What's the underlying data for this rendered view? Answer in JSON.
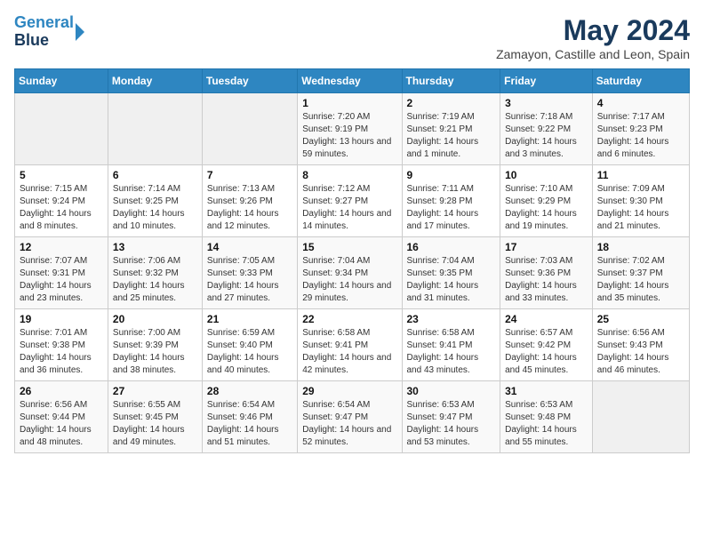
{
  "header": {
    "logo_line1": "General",
    "logo_line2": "Blue",
    "title": "May 2024",
    "subtitle": "Zamayon, Castille and Leon, Spain"
  },
  "days_of_week": [
    "Sunday",
    "Monday",
    "Tuesday",
    "Wednesday",
    "Thursday",
    "Friday",
    "Saturday"
  ],
  "weeks": [
    [
      {
        "day": "",
        "info": ""
      },
      {
        "day": "",
        "info": ""
      },
      {
        "day": "",
        "info": ""
      },
      {
        "day": "1",
        "info": "Sunrise: 7:20 AM\nSunset: 9:19 PM\nDaylight: 13 hours and 59 minutes."
      },
      {
        "day": "2",
        "info": "Sunrise: 7:19 AM\nSunset: 9:21 PM\nDaylight: 14 hours and 1 minute."
      },
      {
        "day": "3",
        "info": "Sunrise: 7:18 AM\nSunset: 9:22 PM\nDaylight: 14 hours and 3 minutes."
      },
      {
        "day": "4",
        "info": "Sunrise: 7:17 AM\nSunset: 9:23 PM\nDaylight: 14 hours and 6 minutes."
      }
    ],
    [
      {
        "day": "5",
        "info": "Sunrise: 7:15 AM\nSunset: 9:24 PM\nDaylight: 14 hours and 8 minutes."
      },
      {
        "day": "6",
        "info": "Sunrise: 7:14 AM\nSunset: 9:25 PM\nDaylight: 14 hours and 10 minutes."
      },
      {
        "day": "7",
        "info": "Sunrise: 7:13 AM\nSunset: 9:26 PM\nDaylight: 14 hours and 12 minutes."
      },
      {
        "day": "8",
        "info": "Sunrise: 7:12 AM\nSunset: 9:27 PM\nDaylight: 14 hours and 14 minutes."
      },
      {
        "day": "9",
        "info": "Sunrise: 7:11 AM\nSunset: 9:28 PM\nDaylight: 14 hours and 17 minutes."
      },
      {
        "day": "10",
        "info": "Sunrise: 7:10 AM\nSunset: 9:29 PM\nDaylight: 14 hours and 19 minutes."
      },
      {
        "day": "11",
        "info": "Sunrise: 7:09 AM\nSunset: 9:30 PM\nDaylight: 14 hours and 21 minutes."
      }
    ],
    [
      {
        "day": "12",
        "info": "Sunrise: 7:07 AM\nSunset: 9:31 PM\nDaylight: 14 hours and 23 minutes."
      },
      {
        "day": "13",
        "info": "Sunrise: 7:06 AM\nSunset: 9:32 PM\nDaylight: 14 hours and 25 minutes."
      },
      {
        "day": "14",
        "info": "Sunrise: 7:05 AM\nSunset: 9:33 PM\nDaylight: 14 hours and 27 minutes."
      },
      {
        "day": "15",
        "info": "Sunrise: 7:04 AM\nSunset: 9:34 PM\nDaylight: 14 hours and 29 minutes."
      },
      {
        "day": "16",
        "info": "Sunrise: 7:04 AM\nSunset: 9:35 PM\nDaylight: 14 hours and 31 minutes."
      },
      {
        "day": "17",
        "info": "Sunrise: 7:03 AM\nSunset: 9:36 PM\nDaylight: 14 hours and 33 minutes."
      },
      {
        "day": "18",
        "info": "Sunrise: 7:02 AM\nSunset: 9:37 PM\nDaylight: 14 hours and 35 minutes."
      }
    ],
    [
      {
        "day": "19",
        "info": "Sunrise: 7:01 AM\nSunset: 9:38 PM\nDaylight: 14 hours and 36 minutes."
      },
      {
        "day": "20",
        "info": "Sunrise: 7:00 AM\nSunset: 9:39 PM\nDaylight: 14 hours and 38 minutes."
      },
      {
        "day": "21",
        "info": "Sunrise: 6:59 AM\nSunset: 9:40 PM\nDaylight: 14 hours and 40 minutes."
      },
      {
        "day": "22",
        "info": "Sunrise: 6:58 AM\nSunset: 9:41 PM\nDaylight: 14 hours and 42 minutes."
      },
      {
        "day": "23",
        "info": "Sunrise: 6:58 AM\nSunset: 9:41 PM\nDaylight: 14 hours and 43 minutes."
      },
      {
        "day": "24",
        "info": "Sunrise: 6:57 AM\nSunset: 9:42 PM\nDaylight: 14 hours and 45 minutes."
      },
      {
        "day": "25",
        "info": "Sunrise: 6:56 AM\nSunset: 9:43 PM\nDaylight: 14 hours and 46 minutes."
      }
    ],
    [
      {
        "day": "26",
        "info": "Sunrise: 6:56 AM\nSunset: 9:44 PM\nDaylight: 14 hours and 48 minutes."
      },
      {
        "day": "27",
        "info": "Sunrise: 6:55 AM\nSunset: 9:45 PM\nDaylight: 14 hours and 49 minutes."
      },
      {
        "day": "28",
        "info": "Sunrise: 6:54 AM\nSunset: 9:46 PM\nDaylight: 14 hours and 51 minutes."
      },
      {
        "day": "29",
        "info": "Sunrise: 6:54 AM\nSunset: 9:47 PM\nDaylight: 14 hours and 52 minutes."
      },
      {
        "day": "30",
        "info": "Sunrise: 6:53 AM\nSunset: 9:47 PM\nDaylight: 14 hours and 53 minutes."
      },
      {
        "day": "31",
        "info": "Sunrise: 6:53 AM\nSunset: 9:48 PM\nDaylight: 14 hours and 55 minutes."
      },
      {
        "day": "",
        "info": ""
      }
    ]
  ]
}
